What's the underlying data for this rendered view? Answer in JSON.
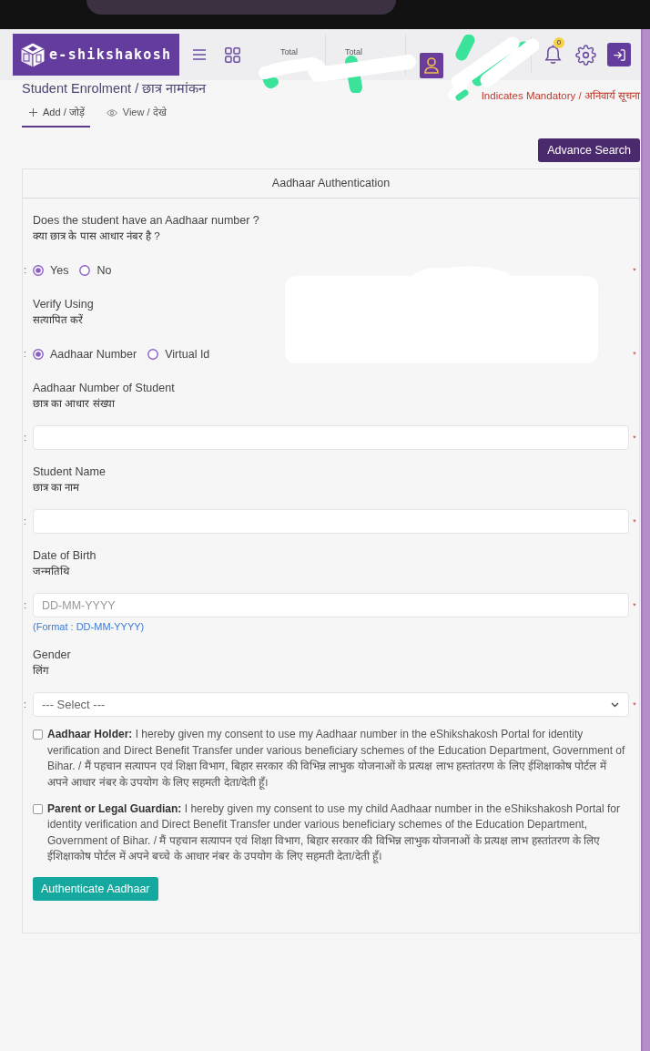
{
  "header": {
    "logo_text": "e-shikshakosh",
    "stats": [
      {
        "label": "Total"
      },
      {
        "label": "Total"
      }
    ],
    "notification_badge": "0"
  },
  "page": {
    "title": "Student Enrolment / छात्र नामांकन",
    "mandatory_note": "Indicates Mandatory / अनिवार्य सूचना"
  },
  "tabs": [
    {
      "kind": "add",
      "label": "Add / जोड़ें",
      "selected": true
    },
    {
      "kind": "view",
      "label": "View / देखे",
      "selected": false
    }
  ],
  "advance_search_button": "Advance Search",
  "form": {
    "title": "Aadhaar Authentication",
    "fields": [
      {
        "kind": "radio",
        "label": "Does the student have an Aadhaar number ?",
        "label_hi": "क्या छात्र के पास आधार नंबर है ?",
        "separator": ":",
        "required_mark": "*",
        "options": [
          {
            "label": "Yes",
            "selected": true
          },
          {
            "label": "No",
            "selected": false
          }
        ]
      },
      {
        "kind": "radio",
        "label": "Verify Using",
        "label_hi": "सत्यापित करें",
        "separator": ":",
        "required_mark": "*",
        "options": [
          {
            "label": "Aadhaar Number",
            "selected": true
          },
          {
            "label": "Virtual Id",
            "selected": false
          }
        ]
      },
      {
        "kind": "text",
        "label": "Aadhaar Number of Student",
        "label_hi": "छात्र का आधार संख्या",
        "separator": ":",
        "required_mark": "*"
      },
      {
        "kind": "text",
        "label": "Student Name",
        "label_hi": "छात्र का नाम",
        "separator": ":",
        "required_mark": "*"
      },
      {
        "kind": "date",
        "label": "Date of Birth",
        "label_hi": "जन्मतिथि",
        "separator": ":",
        "required_mark": "*",
        "placeholder": "DD-MM-YYYY",
        "hint": "(Format : DD-MM-YYYY)"
      },
      {
        "kind": "select",
        "label": "Gender",
        "label_hi": "लिंग",
        "separator": ":",
        "required_mark": "*",
        "value": "--- Select ---"
      }
    ],
    "consents": [
      {
        "checked": false,
        "text": "**Aadhaar Holder:** I hereby given my consent to use my Aadhaar number in the eShikshakosh Portal for identity verification and Direct Benefit Transfer under various beneficiary schemes of the Education Department, Government of Bihar. / मैं पहचान सत्यापन एवं शिक्षा विभाग, बिहार सरकार की विभिन्न लाभुक योजनाओं के प्रत्यक्ष लाभ हस्तांतरण के लिए ईशिक्षाकोष पोर्टल में अपने आधार नंबर के उपयोग के लिए सहमती देता/देती हूँ।"
      },
      {
        "checked": false,
        "text": "**Parent or Legal Guardian:** I hereby given my consent to use my child Aadhaar number in the eShikshakosh Portal for identity verification and Direct Benefit Transfer under various beneficiary schemes of the Education Department, Government of Bihar. / मैं पहचान सत्यापन एवं शिक्षा विभाग, बिहार सरकार की विभिन्न लाभुक योजनाओं के प्रत्यक्ष लाभ हस्तांतरण के लिए ईशिक्षाकोष पोर्टल में अपने बच्चे के आधार नंबर के उपयोग के लिए सहमती देता/देती हूँ।"
      }
    ],
    "submit_button": "Authenticate Aadhaar"
  }
}
